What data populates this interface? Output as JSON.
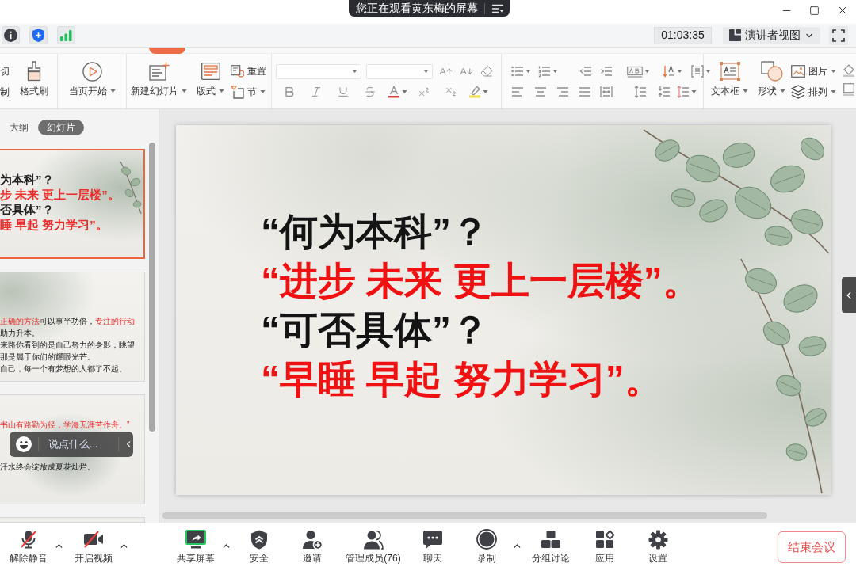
{
  "title_bar": {
    "banner": "您正在观看黄东梅的屏幕"
  },
  "meeting_bar": {
    "timer": "01:03:35",
    "view_menu": "演讲者视图"
  },
  "ribbon": {
    "cut_labels": [
      "切",
      "制"
    ],
    "format_painter": {
      "label": "格式刷",
      "dropdown": false
    },
    "play_from_current": {
      "label": "当页开始",
      "dropdown": true
    },
    "new_slide": {
      "label": "新建幻灯片",
      "dropdown": true
    },
    "layout": {
      "label": "版式",
      "dropdown": true
    },
    "reset": {
      "label": "重置",
      "dropdown": false
    },
    "section": {
      "label": "节",
      "dropdown": true
    },
    "text_box": {
      "label": "文本框",
      "dropdown": true
    },
    "shape": {
      "label": "形状",
      "dropdown": true
    },
    "picture": {
      "label": "图片",
      "dropdown": true
    },
    "arrange": {
      "label": "排列",
      "dropdown": true
    }
  },
  "slide_panel": {
    "tabs": [
      {
        "label": "大纲",
        "selected": false
      },
      {
        "label": "幻灯片",
        "selected": true
      }
    ],
    "slides": [
      {
        "kind": "title",
        "selected": true,
        "lines": [
          {
            "segments": [
              {
                "text": "为本科”？",
                "highlight": false
              }
            ]
          },
          {
            "segments": [
              {
                "text": "步 未来 更上一层楼”。",
                "highlight": true
              }
            ]
          },
          {
            "segments": [
              {
                "text": "否具体”？",
                "highlight": false
              }
            ]
          },
          {
            "segments": [
              {
                "text": "睡 早起 努力学习”。",
                "highlight": true
              }
            ]
          }
        ]
      },
      {
        "kind": "text",
        "selected": false,
        "lines": [
          {
            "segments": [
              {
                "text": "正确的方法",
                "highlight": true
              },
              {
                "text": "可以事半功倍，",
                "highlight": false
              },
              {
                "text": "专注的行动",
                "highlight": true
              }
            ]
          },
          {
            "segments": [
              {
                "text": "助力升本。",
                "highlight": false
              }
            ]
          },
          {
            "segments": [
              {
                "text": "来路你看到的是自己努力的身影，眺望",
                "highlight": false
              }
            ]
          },
          {
            "segments": [
              {
                "text": "那是属于你们的耀眼光芒。",
                "highlight": false
              }
            ]
          },
          {
            "segments": [
              {
                "text": "自己，每一个有梦想的人都了不起。",
                "highlight": false
              }
            ]
          }
        ]
      },
      {
        "kind": "text",
        "selected": false,
        "lines": [
          {
            "segments": [
              {
                "text": "书山有路勤为径，学海无涯苦作舟。”",
                "highlight": true
              }
            ]
          },
          {
            "segments": [
              {
                "text": "汗水终会绽放成夏花灿烂。",
                "highlight": false
              }
            ]
          }
        ]
      },
      {
        "selected": false
      }
    ]
  },
  "chat_box": {
    "placeholder": "说点什么..."
  },
  "slide": {
    "lines": [
      {
        "text": "“何为本科”？",
        "highlight": false
      },
      {
        "text": "“进步 未来 更上一层楼”。",
        "highlight": true
      },
      {
        "text": "“可否具体”？",
        "highlight": false
      },
      {
        "text": "“早睡 早起 努力学习”。",
        "highlight": true
      }
    ]
  },
  "toolbar": {
    "items": [
      {
        "kind": "microphone",
        "label": "解除静音",
        "off": true,
        "dropdown": true
      },
      {
        "kind": "camera",
        "label": "开启视频",
        "off": true,
        "dropdown": true
      },
      {
        "kind": "share",
        "label": "共享屏幕",
        "dropdown": true
      },
      {
        "kind": "security",
        "label": "安全",
        "dropdown": false
      },
      {
        "kind": "invite",
        "label": "邀请",
        "dropdown": false
      },
      {
        "kind": "members",
        "label": "管理成员(76)",
        "dropdown": false
      },
      {
        "kind": "chat",
        "label": "聊天",
        "dropdown": false
      },
      {
        "kind": "record",
        "label": "录制",
        "dropdown": true
      },
      {
        "kind": "breakout",
        "label": "分组讨论",
        "dropdown": false
      },
      {
        "kind": "apps",
        "label": "应用",
        "dropdown": false
      },
      {
        "kind": "settings",
        "label": "设置",
        "dropdown": false
      }
    ],
    "end_button": "结束会议"
  }
}
